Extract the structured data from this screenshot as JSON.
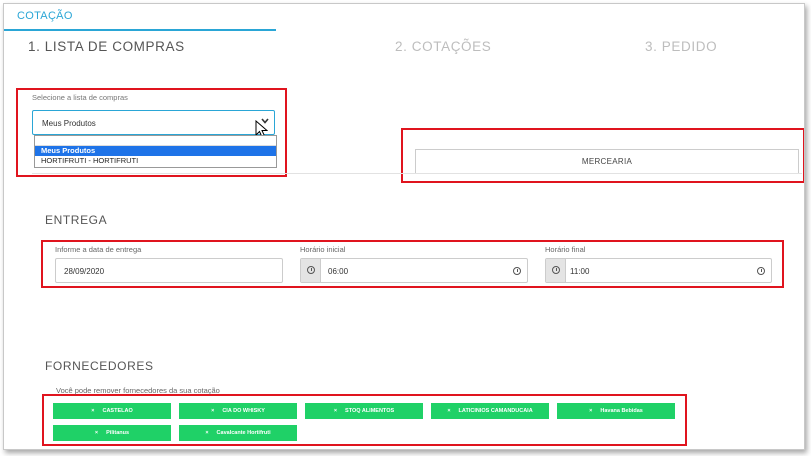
{
  "header": {
    "tab_label": "COTAÇÃO"
  },
  "steps": [
    {
      "label": "1. LISTA DE COMPRAS"
    },
    {
      "label": "2. COTAÇÕES"
    },
    {
      "label": "3. PEDIDO"
    }
  ],
  "list_select": {
    "label": "Selecione a lista de compras",
    "value": "Meus Produtos",
    "options": [
      "Meus Produtos",
      "HORTIFRUTI - HORTIFRUTI"
    ]
  },
  "category_button": {
    "label": "MERCEARIA"
  },
  "delivery": {
    "title": "ENTREGA",
    "date_label": "Informe a data de entrega",
    "date_value": "28/09/2020",
    "start_label": "Horário inicial",
    "start_value": "06:00",
    "end_label": "Horário final",
    "end_value": "11:00"
  },
  "suppliers": {
    "title": "FORNECEDORES",
    "hint": "Você pode remover fornecedores da sua cotação",
    "remove_symbol": "×",
    "items": [
      "CASTELAO",
      "CIA DO WHISKY",
      "STOQ ALIMENTOS",
      "LATICINIOS CAMANDUCAIA",
      "Havana Bebidas",
      "Pilitanus",
      "Cavalcante Hortifruti"
    ]
  },
  "colors": {
    "accent": "#2aa6d6",
    "highlight": "#e0141e",
    "chip": "#1fd167",
    "selected_option": "#1e73e8"
  }
}
